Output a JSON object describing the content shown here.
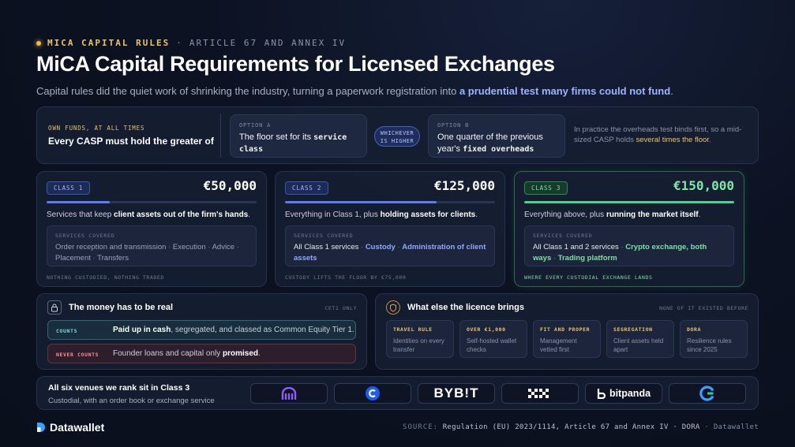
{
  "header": {
    "kicker_main": "MICA CAPITAL RULES",
    "kicker_sep": "·",
    "kicker_sub": "ARTICLE 67 AND ANNEX IV",
    "title": "MiCA Capital Requirements for Licensed Exchanges",
    "subtitle_plain": "Capital rules did the quiet work of shrinking the industry, turning a paperwork registration into ",
    "subtitle_highlight": "a prudential test many firms could not fund",
    "subtitle_end": "."
  },
  "own_funds": {
    "label": "OWN FUNDS, AT ALL TIMES",
    "headline": "Every CASP must hold the greater of",
    "option_a": {
      "label": "OPTION A",
      "text": "The floor set for its ",
      "text_mono": "service class"
    },
    "pill": {
      "line1": "WHICHEVER",
      "line2": "IS HIGHER"
    },
    "option_b": {
      "label": "OPTION B",
      "text": "One quarter of the previous year's ",
      "text_mono": "fixed overheads"
    },
    "note_plain": "In practice the overheads test binds first, so a mid-sized CASP holds ",
    "note_highlight": "several times the floor",
    "note_end": "."
  },
  "classes": [
    {
      "badge": "CLASS 1",
      "amount": "€50,000",
      "fill_fraction": 0.3,
      "desc_plain": "Services that keep ",
      "desc_bold": "client assets out of the firm's hands",
      "desc_end": ".",
      "services_label": "SERVICES COVERED",
      "services": [
        "Order reception and transmission",
        "Execution",
        "Advice",
        "Placement",
        "Transfers"
      ],
      "footer": "NOTHING CUSTODIED, NOTHING TRADED"
    },
    {
      "badge": "CLASS 2",
      "amount": "€125,000",
      "fill_fraction": 0.72,
      "desc_plain": "Everything in Class 1, plus ",
      "desc_bold": "holding assets for clients",
      "desc_end": ".",
      "services_label": "SERVICES COVERED",
      "services_lead": "All Class 1 services",
      "services": [
        "Custody",
        "Administration of client assets"
      ],
      "footer": "CUSTODY LIFTS THE FLOOR BY €75,000"
    },
    {
      "badge": "CLASS 3",
      "amount": "€150,000",
      "fill_fraction": 1.0,
      "desc_plain": "Everything above, plus ",
      "desc_bold": "running the market itself",
      "desc_end": ".",
      "services_label": "SERVICES COVERED",
      "services_lead": "All Class 1 and 2 services",
      "services": [
        "Crypto exchange, both ways",
        "Trading platform"
      ],
      "footer": "WHERE EVERY CUSTODIAL EXCHANGE LANDS"
    }
  ],
  "money": {
    "icon": "lock-icon",
    "title": "The money has to be real",
    "right_tag": "CET1 ONLY",
    "counts": {
      "label": "COUNTS",
      "bold": "Paid up in cash",
      "rest": ", segregated, and classed as Common Equity Tier 1."
    },
    "never": {
      "label": "NEVER COUNTS",
      "plain": "Founder loans and capital only ",
      "bold": "promised",
      "end": "."
    }
  },
  "licence": {
    "icon": "shield-icon",
    "title": "What else the licence brings",
    "right_tag": "NONE OF IT EXISTED BEFORE",
    "tiles": [
      {
        "label": "TRAVEL RULE",
        "desc": "Identities on every transfer"
      },
      {
        "label": "OVER €1,000",
        "desc": "Self-hosted wallet checks"
      },
      {
        "label": "FIT AND PROPER",
        "desc": "Management vetted first"
      },
      {
        "label": "SEGREGATION",
        "desc": "Client assets held apart"
      },
      {
        "label": "DORA",
        "desc": "Resilience rules since 2025"
      }
    ]
  },
  "venues": {
    "title": "All six venues we rank sit in Class 3",
    "subtitle": "Custodial, with an order book or exchange service",
    "logos": [
      {
        "name": "kraken",
        "icon": "kraken-logo-icon",
        "color": "#8d5cf6",
        "text": ""
      },
      {
        "name": "coinbase",
        "icon": "coinbase-logo-icon",
        "color": "#1f5cf0",
        "text": ""
      },
      {
        "name": "bybit",
        "icon": "bybit-logo-icon",
        "color": "#f7a600",
        "text": "BYB!T"
      },
      {
        "name": "okx",
        "icon": "okx-logo-icon",
        "color": "#ffffff",
        "text": ""
      },
      {
        "name": "bitpanda",
        "icon": "bitpanda-logo-icon",
        "color": "#ffffff",
        "text": "bitpanda"
      },
      {
        "name": "gemini-style",
        "icon": "ring-logo-icon",
        "color": "#3aa0ff",
        "text": ""
      }
    ]
  },
  "footer": {
    "brand": "Datawallet",
    "source_label": "SOURCE:",
    "source_text": "Regulation (EU) 2023/1114, Article 67 and Annex IV · DORA",
    "source_sep": "·",
    "source_brand": "Datawallet"
  }
}
